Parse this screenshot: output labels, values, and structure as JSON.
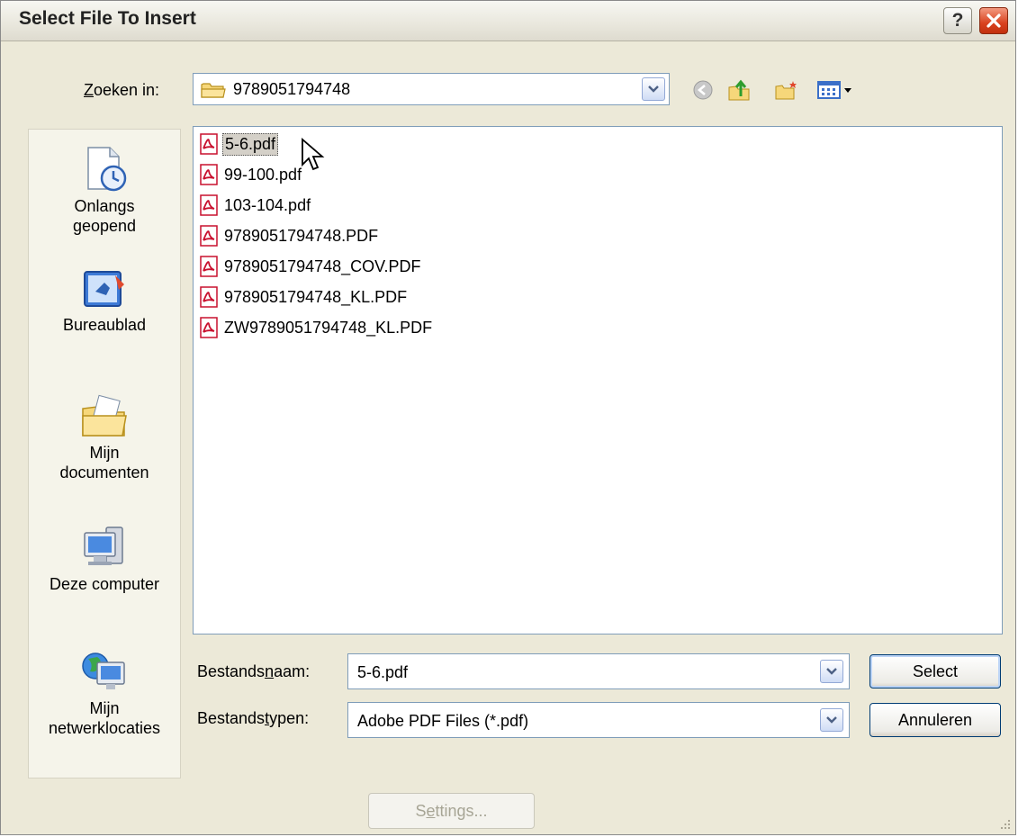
{
  "window": {
    "title": "Select File To Insert"
  },
  "lookin": {
    "label_pre": "",
    "label_accel": "Z",
    "label_post": "oeken in:",
    "value": "9789051794748"
  },
  "places": [
    {
      "label": "Onlangs\ngeopend",
      "icon": "recent-documents-icon"
    },
    {
      "label": "Bureaublad",
      "icon": "desktop-icon"
    },
    {
      "label": "Mijn\ndocumenten",
      "icon": "my-documents-icon"
    },
    {
      "label": "Deze computer",
      "icon": "my-computer-icon"
    },
    {
      "label": "Mijn\nnetwerklocaties",
      "icon": "network-places-icon"
    }
  ],
  "files": [
    {
      "name": "5-6.pdf",
      "selected": true
    },
    {
      "name": "99-100.pdf",
      "selected": false
    },
    {
      "name": "103-104.pdf",
      "selected": false
    },
    {
      "name": "9789051794748.PDF",
      "selected": false
    },
    {
      "name": "9789051794748_COV.PDF",
      "selected": false
    },
    {
      "name": "9789051794748_KL.PDF",
      "selected": false
    },
    {
      "name": "ZW9789051794748_KL.PDF",
      "selected": false
    }
  ],
  "filename": {
    "label_pre": "Bestands",
    "label_accel": "n",
    "label_post": "aam:",
    "value": "5-6.pdf"
  },
  "filetype": {
    "label_pre": "Bestands",
    "label_accel": "t",
    "label_post": "ypen:",
    "value": "Adobe PDF Files (*.pdf)"
  },
  "buttons": {
    "select": "Select",
    "cancel": "Annuleren",
    "settings_pre": "S",
    "settings_accel": "e",
    "settings_post": "ttings..."
  },
  "colors": {
    "dialog_bg": "#ece9d8",
    "list_border": "#7f9db9",
    "close_red": "#d9421f",
    "pdf_red": "#c8102e"
  }
}
